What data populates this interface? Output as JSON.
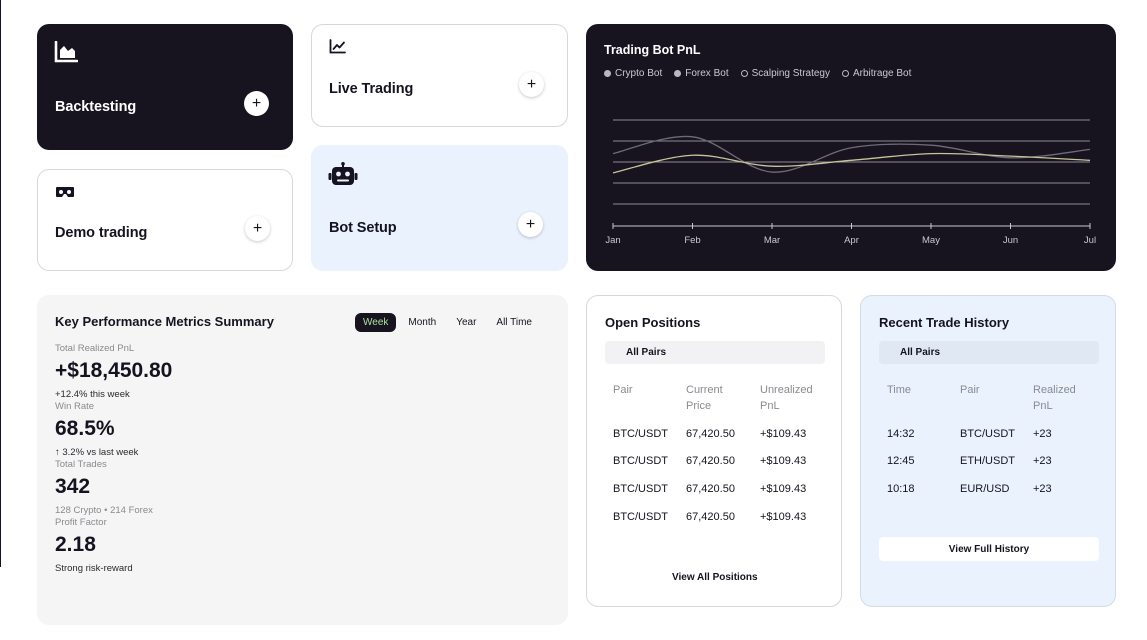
{
  "cards": {
    "backtesting": {
      "title": "Backtesting",
      "icon": "area-chart-icon"
    },
    "live_trading": {
      "title": "Live Trading",
      "icon": "line-chart-icon"
    },
    "demo_trading": {
      "title": "Demo trading",
      "icon": "vr-goggles-icon"
    },
    "bot_setup": {
      "title": "Bot Setup",
      "icon": "robot-icon"
    },
    "add_symbol": "+"
  },
  "pnl_chart": {
    "title": "Trading Bot PnL",
    "legend": [
      {
        "label": "Crypto Bot",
        "style": "filled"
      },
      {
        "label": "Forex Bot",
        "style": "filled"
      },
      {
        "label": "Scalping Strategy",
        "style": "hollow"
      },
      {
        "label": "Arbitrage Bot",
        "style": "hollow"
      }
    ]
  },
  "chart_data": {
    "type": "line",
    "title": "Trading Bot PnL",
    "categories": [
      "Jan",
      "Feb",
      "Mar",
      "Apr",
      "May",
      "Jun",
      "Jul"
    ],
    "ylim": [
      0,
      100
    ],
    "grid": true,
    "legend_position": "top-left",
    "series": [
      {
        "name": "Crypto Bot",
        "color": "#6e6b78",
        "values": [
          60,
          80,
          38,
          67,
          70,
          55,
          65
        ]
      },
      {
        "name": "Forex Bot",
        "color": "#c8c49a",
        "values": [
          37,
          58,
          45,
          52,
          60,
          57,
          52
        ]
      },
      {
        "name": "Scalping Strategy",
        "color": null,
        "values": []
      },
      {
        "name": "Arbitrage Bot",
        "color": null,
        "values": []
      }
    ]
  },
  "kpi": {
    "title": "Key Performance Metrics Summary",
    "tabs": [
      "Week",
      "Month",
      "Year",
      "All Time"
    ],
    "active_tab": "Week",
    "metrics": [
      {
        "label": "Total Realized PnL",
        "value": "+$18,450.80",
        "sub": "+12.4% this week"
      },
      {
        "label": "Win Rate",
        "value": "68.5%",
        "sub": "↑ 3.2% vs last week"
      },
      {
        "label": "Total Trades",
        "value": "342",
        "sub": "128 Crypto • 214 Forex"
      },
      {
        "label": "Profit Factor",
        "value": "2.18",
        "sub": "Strong risk-reward"
      }
    ]
  },
  "open_positions": {
    "title": "Open Positions",
    "filter": "All Pairs",
    "headers": [
      "Pair",
      "Current Price",
      "Unrealized PnL"
    ],
    "rows": [
      [
        "BTC/USDT",
        "67,420.50",
        "+$109.43"
      ],
      [
        "BTC/USDT",
        "67,420.50",
        "+$109.43"
      ],
      [
        "BTC/USDT",
        "67,420.50",
        "+$109.43"
      ],
      [
        "BTC/USDT",
        "67,420.50",
        "+$109.43"
      ]
    ],
    "view_all": "View All Positions"
  },
  "trade_history": {
    "title": "Recent Trade History",
    "filter": "All Pairs",
    "headers": [
      "Time",
      "Pair",
      "Realized PnL"
    ],
    "rows": [
      [
        "14:32",
        "BTC/USDT",
        "+23"
      ],
      [
        "12:45",
        "ETH/USDT",
        "+23"
      ],
      [
        "10:18",
        "EUR/USD",
        "+23"
      ]
    ],
    "view_full": "View Full History"
  }
}
